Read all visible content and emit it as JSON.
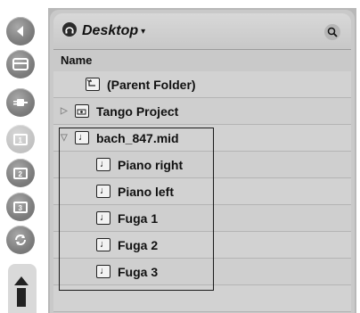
{
  "browser": {
    "location": {
      "title": "Desktop",
      "caret": "▾",
      "icon": "headphones-icon",
      "search_icon": "magnifier-icon"
    },
    "column_header": "Name",
    "rows": [
      {
        "label": "(Parent Folder)",
        "icon": "parent-folder-icon",
        "expander": ""
      },
      {
        "label": "Tango Project",
        "icon": "project-folder-icon",
        "expander": "▷"
      },
      {
        "label": "bach_847.mid",
        "icon": "midi-file-icon",
        "expander": "▽"
      },
      {
        "label": "Piano right",
        "icon": "midi-clip-icon",
        "expander": ""
      },
      {
        "label": "Piano left",
        "icon": "midi-clip-icon",
        "expander": ""
      },
      {
        "label": "Fuga 1",
        "icon": "midi-clip-icon",
        "expander": ""
      },
      {
        "label": "Fuga 2",
        "icon": "midi-clip-icon",
        "expander": ""
      },
      {
        "label": "Fuga 3",
        "icon": "midi-clip-icon",
        "expander": ""
      },
      {
        "label": "",
        "icon": "",
        "expander": ""
      }
    ]
  },
  "sidebar": {
    "buttons": [
      {
        "name": "back-arrow-icon"
      },
      {
        "name": "device-browser-icon"
      },
      {
        "name": "plugin-browser-icon"
      },
      {
        "name": "file-browser-1-icon"
      },
      {
        "name": "file-browser-2-icon"
      },
      {
        "name": "file-browser-3-icon"
      },
      {
        "name": "refresh-icon"
      }
    ],
    "tab_icon": "resize-handle-icon"
  },
  "colors": {
    "panel": "#c9c9c9",
    "row": "#d2d2d2",
    "button": "#8a8a8a",
    "selection_border": "#1a1a1a"
  }
}
